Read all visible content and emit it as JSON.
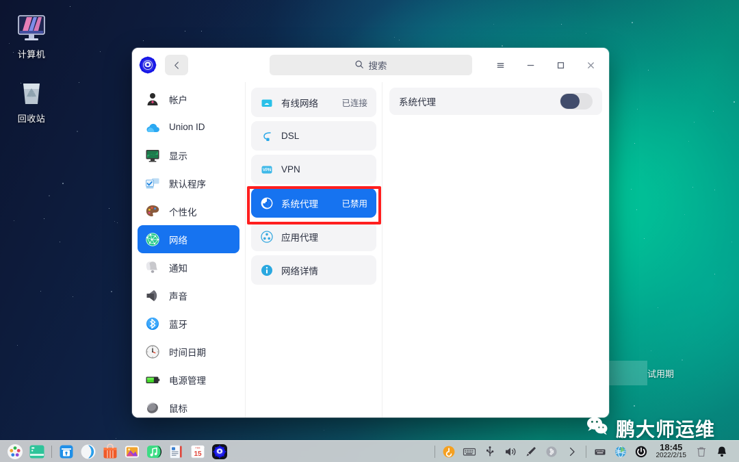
{
  "desktop": {
    "icons": [
      {
        "name": "computer",
        "label": "计算机"
      },
      {
        "name": "recycle-bin",
        "label": "回收站"
      }
    ],
    "trial_text": "试用期",
    "watermark_text": "鹏大师运维"
  },
  "window": {
    "app_icon": "deepin-settings-icon",
    "back_label": "‹",
    "search": {
      "icon": "search-icon",
      "placeholder": "搜索",
      "value": ""
    },
    "controls": [
      {
        "name": "menu-button",
        "glyph": "≡"
      },
      {
        "name": "minimize-button",
        "glyph": "—"
      },
      {
        "name": "maximize-button",
        "glyph": "□"
      },
      {
        "name": "close-button",
        "glyph": "✕"
      }
    ]
  },
  "sidebar": {
    "items": [
      {
        "label": "帐户",
        "icon": "account-icon",
        "selected": false
      },
      {
        "label": "Union ID",
        "icon": "cloud-icon",
        "selected": false
      },
      {
        "label": "显示",
        "icon": "display-icon",
        "selected": false
      },
      {
        "label": "默认程序",
        "icon": "default-apps-icon",
        "selected": false
      },
      {
        "label": "个性化",
        "icon": "personalization-icon",
        "selected": false
      },
      {
        "label": "网络",
        "icon": "network-icon",
        "selected": true
      },
      {
        "label": "通知",
        "icon": "notification-icon",
        "selected": false
      },
      {
        "label": "声音",
        "icon": "sound-icon",
        "selected": false
      },
      {
        "label": "蓝牙",
        "icon": "bluetooth-icon",
        "selected": false
      },
      {
        "label": "时间日期",
        "icon": "datetime-icon",
        "selected": false
      },
      {
        "label": "电源管理",
        "icon": "power-icon",
        "selected": false
      },
      {
        "label": "鼠标",
        "icon": "mouse-icon",
        "selected": false
      }
    ]
  },
  "network_list": {
    "items": [
      {
        "label": "有线网络",
        "status": "已连接",
        "icon": "wired-network-icon",
        "active": false
      },
      {
        "label": "DSL",
        "status": "",
        "icon": "dsl-icon",
        "active": false
      },
      {
        "label": "VPN",
        "status": "",
        "icon": "vpn-icon",
        "active": false
      },
      {
        "label": "系统代理",
        "status": "已禁用",
        "icon": "system-proxy-icon",
        "active": true
      },
      {
        "label": "应用代理",
        "status": "",
        "icon": "app-proxy-icon",
        "active": false
      },
      {
        "label": "网络详情",
        "status": "",
        "icon": "info-icon",
        "active": false
      }
    ],
    "annotation": {
      "target": "系统代理",
      "color": "#ff1f1f"
    }
  },
  "detail_pane": {
    "proxy_label": "系统代理",
    "toggle_state": "off"
  },
  "taskbar": {
    "launchers": [
      "launcher-icon",
      "terminal-icon",
      "app-store-icon",
      "browser-icon",
      "software-center-icon",
      "gallery-icon",
      "music-icon",
      "document-icon",
      "calendar-icon",
      "settings-icon"
    ],
    "calendar_day": "15",
    "tray": [
      "ubuntu-kylin-icon",
      "keyboard-icon",
      "usb-icon",
      "volume-icon",
      "pen-icon",
      "bluetooth-tray-icon",
      "expand-arrow-icon"
    ],
    "tray2": [
      "keyboard-layout-icon",
      "network-tray-icon",
      "power-tray-icon"
    ],
    "clock": {
      "time": "18:45",
      "date": "2022/2/15"
    },
    "end_icons": [
      "trash-tray-icon",
      "notification-bell-icon"
    ]
  },
  "colors": {
    "accent_blue": "#1673f0",
    "annotation_red": "#ff1f1f",
    "toggle_knob": "#414c6b",
    "panel_gray": "#f4f4f6"
  }
}
